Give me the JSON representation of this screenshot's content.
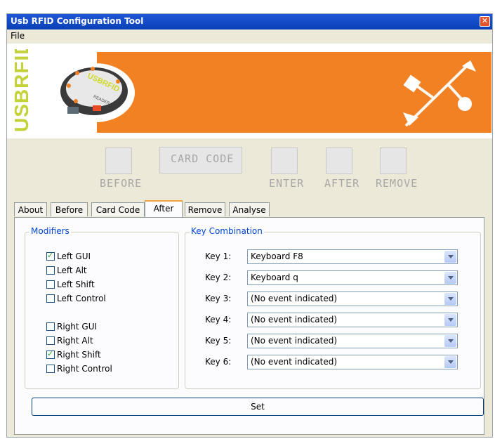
{
  "window": {
    "title": "Usb RFID Configuration Tool",
    "close_glyph": "✕"
  },
  "menu": {
    "file": "File"
  },
  "banner": {
    "brand_text": "USBRFID",
    "reader_text_1": "USBRFID",
    "reader_text_2": "READER",
    "accent_color": "#f28124",
    "brand_color": "#c4d23a"
  },
  "steps": {
    "card_code": "CARD CODE",
    "before": "BEFORE",
    "enter": "ENTER",
    "after": "AFTER",
    "remove": "REMOVE"
  },
  "tabs": [
    {
      "label": "About"
    },
    {
      "label": "Before"
    },
    {
      "label": "Card Code"
    },
    {
      "label": "After"
    },
    {
      "label": "Remove"
    },
    {
      "label": "Analyse"
    }
  ],
  "active_tab": "After",
  "modifiers": {
    "legend": "Modifiers",
    "items": [
      {
        "label": "Left GUI",
        "checked": true
      },
      {
        "label": "Left Alt",
        "checked": false
      },
      {
        "label": "Left Shift",
        "checked": false
      },
      {
        "label": "Left Control",
        "checked": false
      },
      {
        "label": "Right GUI",
        "checked": false
      },
      {
        "label": "Right Alt",
        "checked": false
      },
      {
        "label": "Right Shift",
        "checked": true
      },
      {
        "label": "Right Control",
        "checked": false
      }
    ]
  },
  "key_combination": {
    "legend": "Key Combination",
    "keys": [
      {
        "label": "Key 1:",
        "value": "Keyboard F8"
      },
      {
        "label": "Key 2:",
        "value": "Keyboard q"
      },
      {
        "label": "Key 3:",
        "value": "(No event indicated)"
      },
      {
        "label": "Key 4:",
        "value": "(No event indicated)"
      },
      {
        "label": "Key 5:",
        "value": "(No event indicated)"
      },
      {
        "label": "Key 6:",
        "value": "(No event indicated)"
      }
    ]
  },
  "set_button": "Set"
}
